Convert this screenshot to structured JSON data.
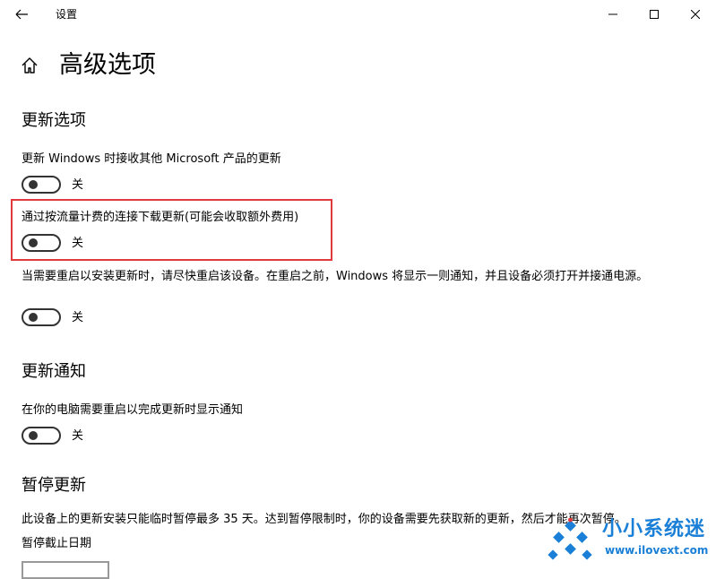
{
  "window": {
    "title": "设置",
    "controls": [
      "minimize",
      "maximize",
      "close"
    ]
  },
  "page": {
    "title": "高级选项"
  },
  "sections": {
    "update_options": {
      "heading": "更新选项",
      "settings": [
        {
          "label": "更新 Windows 时接收其他 Microsoft 产品的更新",
          "state": "关",
          "on": false
        },
        {
          "label": "通过按流量计费的连接下载更新(可能会收取额外费用)",
          "state": "关",
          "on": false,
          "highlighted": true
        },
        {
          "label": "当需要重启以安装更新时，请尽快重启该设备。在重启之前，Windows 将显示一则通知，并且设备必须打开并接通电源。",
          "state": "关",
          "on": false
        }
      ]
    },
    "update_notifications": {
      "heading": "更新通知",
      "settings": [
        {
          "label": "在你的电脑需要重启以完成更新时显示通知",
          "state": "关",
          "on": false
        }
      ]
    },
    "pause_updates": {
      "heading": "暂停更新",
      "description": "此设备上的更新安装只能临时暂停最多 35 天。达到暂停限制时，你的设备需要先获取新的更新，然后才能再次暂停。",
      "date_label": "暂停截止日期"
    }
  },
  "watermark": {
    "name": "小小系统迷",
    "url": "www.ilovext.com"
  },
  "colors": {
    "highlight": "#e0393e",
    "watermark": "#1a7fd6",
    "toggle": "#333333"
  }
}
